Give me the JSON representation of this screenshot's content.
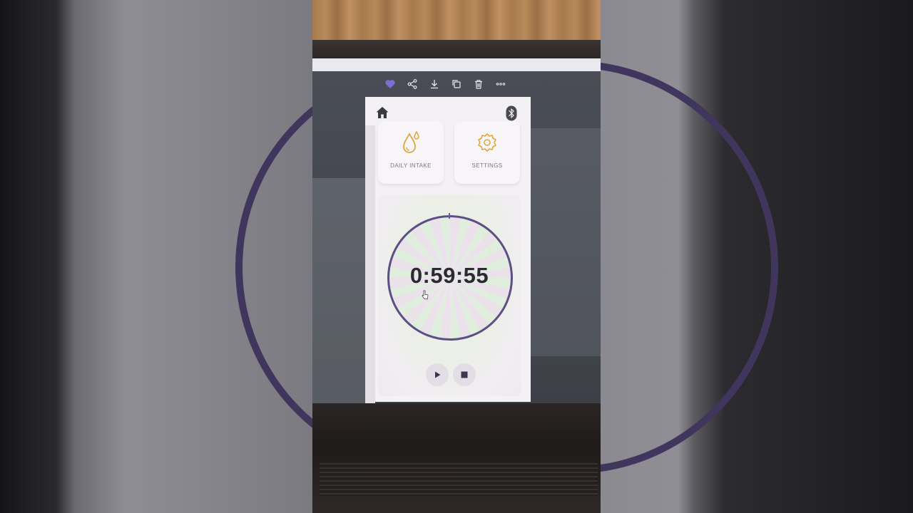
{
  "viewer_toolbar": {
    "icons": [
      "heart-icon",
      "share-icon",
      "download-icon",
      "copy-icon",
      "trash-icon",
      "more-icon"
    ],
    "favorite_color": "#7b6fd6"
  },
  "app": {
    "header": {
      "home_icon": "home-icon",
      "bluetooth_icon": "bluetooth-icon"
    },
    "cards": [
      {
        "label": "DAILY INTAKE",
        "icon": "water-drop-icon"
      },
      {
        "label": "SETTINGS",
        "icon": "gear-icon"
      }
    ],
    "timer": {
      "time": "0:59:55",
      "ring_color": "#5c4f85"
    },
    "controls": {
      "play_icon": "play-icon",
      "stop_icon": "stop-icon"
    },
    "accent_color": "#e0a73c"
  }
}
